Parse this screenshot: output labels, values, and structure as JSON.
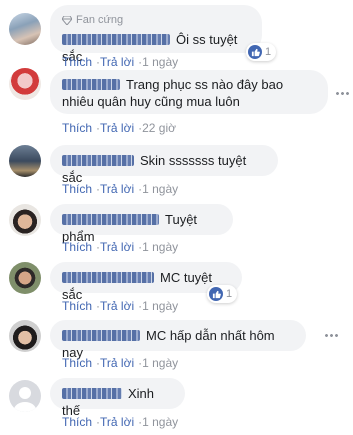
{
  "comments": [
    {
      "badge": "Fan cứng",
      "text": "Ôi ss tuyệt sắc",
      "actions": {
        "like": "Thích",
        "reply": "Trả lời",
        "time": "1 ngày"
      },
      "reaction_count": "1"
    },
    {
      "text": "Trang phục ss nào đây bao nhiêu quân huy cũng mua luôn",
      "actions": {
        "like": "Thích",
        "reply": "Trả lời",
        "time": "22 giờ"
      }
    },
    {
      "text": "Skin sssssss tuyệt sắc",
      "actions": {
        "like": "Thích",
        "reply": "Trả lời",
        "time": "1 ngày"
      }
    },
    {
      "text": "Tuyệt phẩm",
      "actions": {
        "like": "Thích",
        "reply": "Trả lời",
        "time": "1 ngày"
      }
    },
    {
      "text": "MC tuyệt sắc",
      "actions": {
        "like": "Thích",
        "reply": "Trả lời",
        "time": "1 ngày"
      },
      "reaction_count": "1"
    },
    {
      "text": "MC hấp dẫn nhất hôm nay",
      "actions": {
        "like": "Thích",
        "reply": "Trả lời",
        "time": "1 ngày"
      }
    },
    {
      "text": "Xinh thế",
      "actions": {
        "like": "Thích",
        "reply": "Trả lời",
        "time": "1 ngày"
      }
    }
  ],
  "colors": {
    "bubble": "#f2f3f5",
    "link": "#4267b2",
    "meta": "#90949c",
    "like": "#4267b2"
  },
  "separator": "·"
}
